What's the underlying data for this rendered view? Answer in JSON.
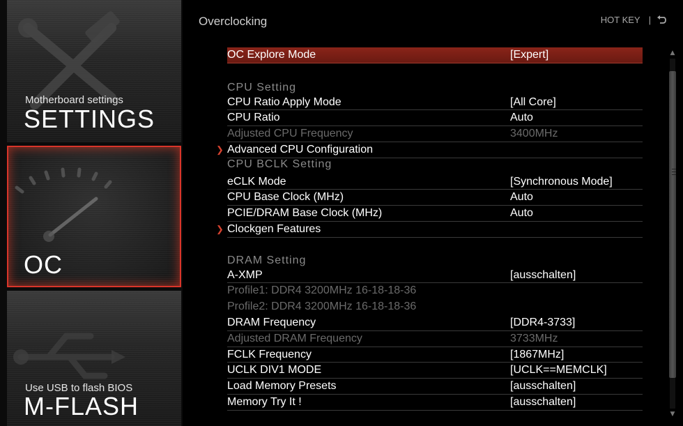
{
  "sidebar": {
    "settings": {
      "subtitle": "Motherboard settings",
      "title": "SETTINGS"
    },
    "oc": {
      "title": "OC"
    },
    "mflash": {
      "subtitle": "Use USB to flash BIOS",
      "title": "M-FLASH"
    }
  },
  "header": {
    "title": "Overclocking",
    "hotkey": "HOT KEY",
    "separator": "|",
    "back_icon": "undo-arrow-icon"
  },
  "menu": {
    "oc_explore_mode": {
      "label": "OC Explore Mode",
      "value": "[Expert]"
    },
    "cpu_section": "CPU  Setting",
    "cpu_ratio_apply_mode": {
      "label": "CPU Ratio Apply Mode",
      "value": "[All Core]"
    },
    "cpu_ratio": {
      "label": "CPU Ratio",
      "value": "Auto"
    },
    "adjusted_cpu_frequency": {
      "label": "Adjusted CPU Frequency",
      "value": "3400MHz"
    },
    "advanced_cpu_configuration": {
      "label": "Advanced CPU Configuration"
    },
    "bclk_section": "CPU  BCLK  Setting",
    "eclk_mode": {
      "label": "eCLK Mode",
      "value": "[Synchronous Mode]"
    },
    "cpu_base_clock": {
      "label": "CPU Base Clock (MHz)",
      "value": "Auto"
    },
    "pcie_dram_base_clock": {
      "label": "PCIE/DRAM Base Clock (MHz)",
      "value": "Auto"
    },
    "clockgen_features": {
      "label": "Clockgen Features"
    },
    "dram_section": "DRAM  Setting",
    "a_xmp": {
      "label": "A-XMP",
      "value": "[ausschalten]"
    },
    "profile1": {
      "label": "Profile1: DDR4 3200MHz 16-18-18-36"
    },
    "profile2": {
      "label": "Profile2: DDR4 3200MHz 16-18-18-36"
    },
    "dram_frequency": {
      "label": "DRAM Frequency",
      "value": "[DDR4-3733]"
    },
    "adjusted_dram_frequency": {
      "label": "Adjusted DRAM Frequency",
      "value": "3733MHz"
    },
    "fclk_frequency": {
      "label": "FCLK Frequency",
      "value": "[1867MHz]"
    },
    "uclk_div1_mode": {
      "label": "UCLK DIV1 MODE",
      "value": "[UCLK==MEMCLK]"
    },
    "load_memory_presets": {
      "label": "Load Memory Presets",
      "value": "[ausschalten]"
    },
    "memory_try_it": {
      "label": "Memory Try It !",
      "value": "[ausschalten]"
    }
  },
  "arrow_glyph": "❯",
  "colors": {
    "accent": "#d9352a",
    "selected_row": "#7a1f15",
    "disabled_text": "#6a6a6a",
    "section_text": "#8a8a8a"
  }
}
